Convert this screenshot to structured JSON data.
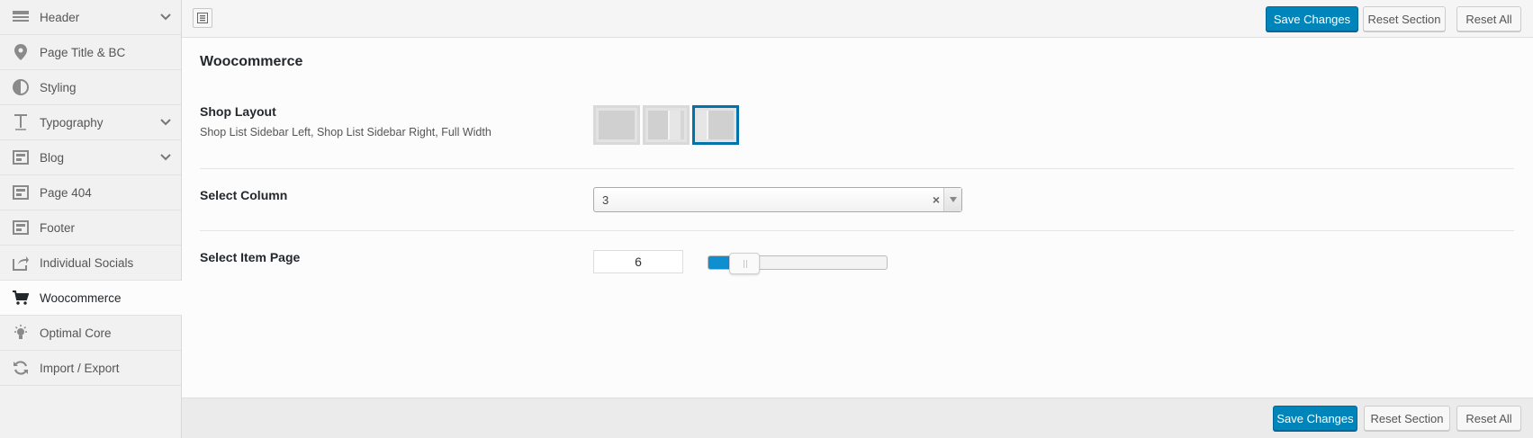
{
  "sidebar": {
    "items": [
      {
        "label": "Header",
        "icon": "header-icon",
        "has_submenu": true
      },
      {
        "label": "Page Title & BC",
        "icon": "location-pin-icon",
        "has_submenu": false
      },
      {
        "label": "Styling",
        "icon": "contrast-icon",
        "has_submenu": false
      },
      {
        "label": "Typography",
        "icon": "text-t-icon",
        "has_submenu": true
      },
      {
        "label": "Blog",
        "icon": "layout-icon",
        "has_submenu": true
      },
      {
        "label": "Page 404",
        "icon": "layout-icon",
        "has_submenu": false
      },
      {
        "label": "Footer",
        "icon": "layout-icon",
        "has_submenu": false
      },
      {
        "label": "Individual Socials",
        "icon": "share-icon",
        "has_submenu": false
      },
      {
        "label": "Woocommerce",
        "icon": "cart-icon",
        "has_submenu": false,
        "active": true
      },
      {
        "label": "Optimal Core",
        "icon": "lightbulb-icon",
        "has_submenu": false
      },
      {
        "label": "Import / Export",
        "icon": "refresh-icon",
        "has_submenu": false
      }
    ]
  },
  "toolbar": {
    "save_label": "Save Changes",
    "reset_section_label": "Reset Section",
    "reset_all_label": "Reset All"
  },
  "section": {
    "title": "Woocommerce",
    "shop_layout": {
      "label": "Shop Layout",
      "description": "Shop List Sidebar Left, Shop List Sidebar Right, Full Width",
      "selected_option": "Full Width"
    },
    "select_column": {
      "label": "Select Column",
      "value": "3"
    },
    "select_item_page": {
      "label": "Select Item Page",
      "value": "6",
      "slider_fraction": 0.2
    }
  },
  "colors": {
    "primary": "#0085ba",
    "selected_border": "#0073aa",
    "slider_fill": "#0f8fd0"
  }
}
